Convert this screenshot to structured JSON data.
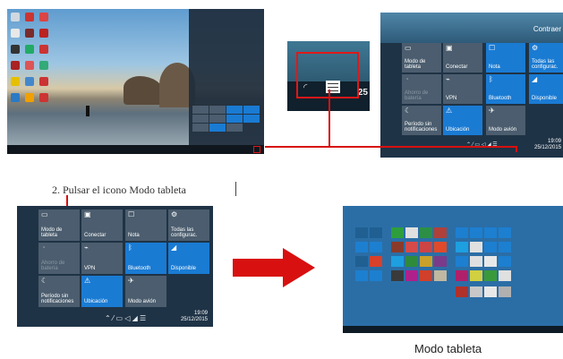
{
  "step_label": "2. Pulsar el icono Modo tableta",
  "caption": "Modo tableta",
  "zoom": {
    "clock_fragment": "25"
  },
  "top_right": {
    "collapse_label": "Contraer",
    "tiles": [
      {
        "label": "Modo de tableta",
        "icon": "tablet-mode-icon",
        "state": "off"
      },
      {
        "label": "Conectar",
        "icon": "connect-icon",
        "state": "off"
      },
      {
        "label": "Nota",
        "icon": "note-icon",
        "state": "on"
      },
      {
        "label": "Todas las configurac.",
        "icon": "gear-icon",
        "state": "on"
      },
      {
        "label": "Ahorro de batería",
        "icon": "battery-saver-icon",
        "state": "dim"
      },
      {
        "label": "VPN",
        "icon": "vpn-icon",
        "state": "off"
      },
      {
        "label": "Bluetooth",
        "icon": "bluetooth-icon",
        "state": "on"
      },
      {
        "label": "Disponible",
        "icon": "network-icon",
        "state": "on"
      },
      {
        "label": "Período sin notificaciones",
        "icon": "moon-icon",
        "state": "off"
      },
      {
        "label": "Ubicación",
        "icon": "location-icon",
        "state": "on"
      },
      {
        "label": "Modo avión",
        "icon": "airplane-icon",
        "state": "off"
      }
    ],
    "clock": {
      "time": "19:09",
      "date": "25/12/2015"
    }
  },
  "bottom_left": {
    "tiles": [
      {
        "label": "Modo de tableta",
        "icon": "tablet-mode-icon",
        "state": "off"
      },
      {
        "label": "Conectar",
        "icon": "connect-icon",
        "state": "off"
      },
      {
        "label": "Nota",
        "icon": "note-icon",
        "state": "off"
      },
      {
        "label": "Todas las configurac.",
        "icon": "gear-icon",
        "state": "off"
      },
      {
        "label": "Ahorro de batería",
        "icon": "battery-saver-icon",
        "state": "dim"
      },
      {
        "label": "VPN",
        "icon": "vpn-icon",
        "state": "off"
      },
      {
        "label": "Bluetooth",
        "icon": "bluetooth-icon",
        "state": "on"
      },
      {
        "label": "Disponible",
        "icon": "network-icon",
        "state": "on"
      },
      {
        "label": "Período sin notificaciones",
        "icon": "moon-icon",
        "state": "off"
      },
      {
        "label": "Ubicación",
        "icon": "location-icon",
        "state": "on"
      },
      {
        "label": "Modo avión",
        "icon": "airplane-icon",
        "state": "off"
      }
    ],
    "clock": {
      "time": "19:09",
      "date": "25/12/2015"
    }
  },
  "colors": {
    "accent": "#1a7bd3",
    "arrow": "#d81010",
    "tile_off": "#4b5d6e"
  }
}
